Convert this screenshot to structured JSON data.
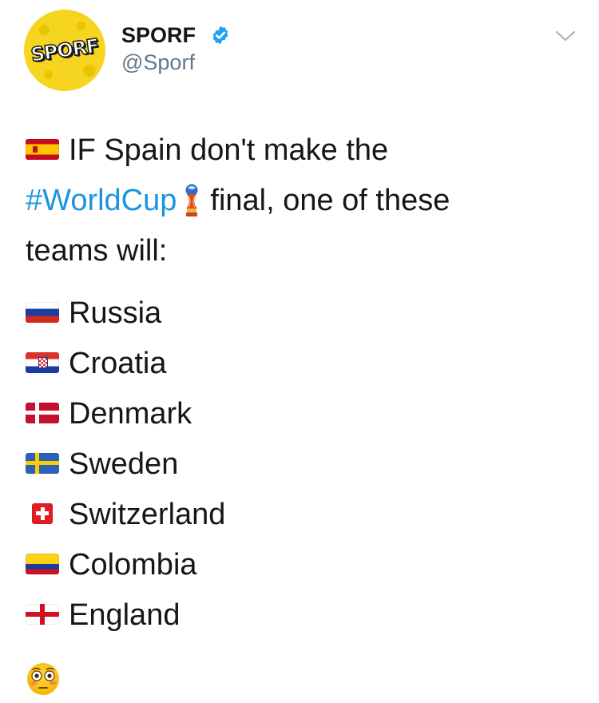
{
  "account": {
    "display_name": "SPORF",
    "handle": "@Sporf",
    "avatar_text": "SPORF",
    "verified": true
  },
  "icons": {
    "verified": "verified-badge-icon",
    "menu": "chevron-down-icon",
    "trophy": "world-cup-trophy-icon",
    "emoji_end": "flushed-face-emoji"
  },
  "tweet": {
    "line1": "IF Spain don't make the",
    "hashtag": "#WorldCup",
    "line2_rest": "final, one of these",
    "line3": "teams will:",
    "teams": [
      {
        "flag": "spain-flag-icon",
        "name": "Russia"
      },
      {
        "flag": "croatia-flag-icon",
        "name": "Croatia"
      },
      {
        "flag": "denmark-flag-icon",
        "name": "Denmark"
      },
      {
        "flag": "sweden-flag-icon",
        "name": "Sweden"
      },
      {
        "flag": "switzerland-flag-icon",
        "name": "Switzerland"
      },
      {
        "flag": "colombia-flag-icon",
        "name": "Colombia"
      },
      {
        "flag": "england-flag-icon",
        "name": "England"
      }
    ]
  },
  "colors": {
    "link": "#1b95e0",
    "text": "#14171a",
    "secondary": "#657786",
    "verified": "#1da1f2",
    "avatar_bg": "#f6d520"
  }
}
